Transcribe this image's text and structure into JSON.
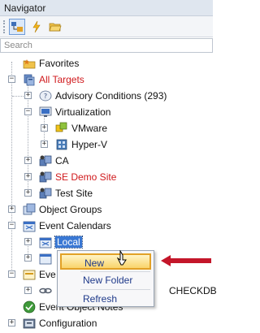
{
  "window": {
    "title": "Navigator"
  },
  "toolbar": {
    "buttons": [
      "navigator-view-icon",
      "lightning-icon",
      "folder-open-icon"
    ]
  },
  "search": {
    "placeholder": "Search"
  },
  "tree": {
    "favorites": "Favorites",
    "all_targets": "All Targets",
    "advisory_conditions": "Advisory Conditions (293)",
    "virtualization": "Virtualization",
    "vmware": "VMware",
    "hyperv": "Hyper-V",
    "ca": "CA",
    "se_demo_site": "SE Demo Site",
    "test_site": "Test Site",
    "object_groups": "Object Groups",
    "event_calendars": "Event Calendars",
    "local": "Local",
    "partial_event": "Eve",
    "partial_checkdb": "CHECKDB",
    "partial_event_notes": "Event      Object Notes",
    "configuration": "Configuration"
  },
  "context_menu": {
    "items": [
      "New",
      "New Folder",
      "Refresh"
    ],
    "highlighted": "New"
  },
  "colors": {
    "highlight_red": "#d0191c",
    "selection_blue": "#3a78d4",
    "menu_hover": "#f9d46b",
    "callout_arrow": "#c4162a"
  }
}
